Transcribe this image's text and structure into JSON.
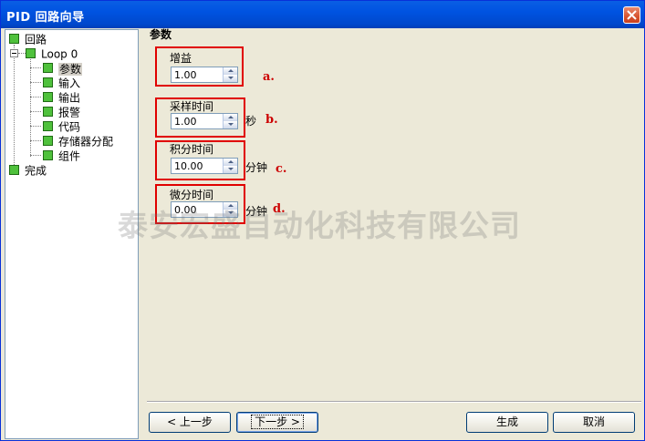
{
  "window": {
    "title": "PID 回路向导"
  },
  "tree": {
    "root": "回路",
    "loop": "Loop 0",
    "children": [
      "参数",
      "输入",
      "输出",
      "报警",
      "代码",
      "存储器分配",
      "组件"
    ],
    "done": "完成"
  },
  "panel": {
    "heading": "参数",
    "fields": [
      {
        "label": "增益",
        "value": "1.00",
        "unit": "",
        "marker": "a."
      },
      {
        "label": "采样时间",
        "value": "1.00",
        "unit": "秒",
        "marker": "b."
      },
      {
        "label": "积分时间",
        "value": "10.00",
        "unit": "分钟",
        "marker": "c."
      },
      {
        "label": "微分时间",
        "value": "0.00",
        "unit": "分钟",
        "marker": "d."
      }
    ]
  },
  "watermark": "泰安宏盛自动化科技有限公司",
  "buttons": {
    "prev": "< 上一步",
    "next": "下一步 >",
    "generate": "生成",
    "cancel": "取消"
  },
  "colors": {
    "titlebar": "#0053e1",
    "highlight": "#e00000",
    "tree_box": "#4fc13c"
  }
}
